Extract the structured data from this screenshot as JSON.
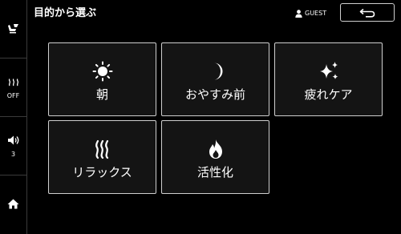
{
  "header": {
    "title": "目的から選ぶ",
    "user_label": "GUEST",
    "back_icon": "back-arrow-icon"
  },
  "sidebar": {
    "seat_icon": "seat-icon",
    "heater_label": "OFF",
    "volume_value": "3",
    "home_icon": "home-icon"
  },
  "tiles": [
    {
      "label": "朝",
      "icon": "sun-icon"
    },
    {
      "label": "おやすみ前",
      "icon": "moon-icon"
    },
    {
      "label": "疲れケア",
      "icon": "sparkle-icon"
    },
    {
      "label": "リラックス",
      "icon": "steam-icon"
    },
    {
      "label": "活性化",
      "icon": "flame-icon"
    }
  ]
}
